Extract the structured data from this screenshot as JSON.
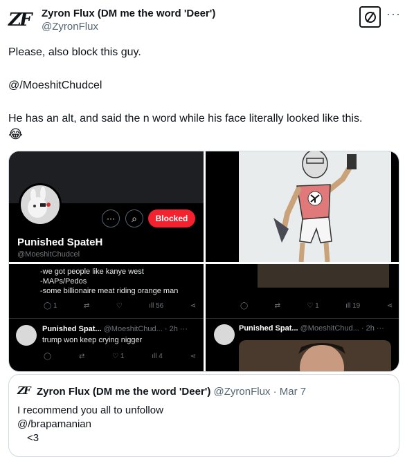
{
  "author": {
    "logo": "ZF",
    "name": "Zyron Flux (DM me the word 'Deer')",
    "handle": "@ZyronFlux",
    "more": "···"
  },
  "tweet": {
    "line1": "Please, also block this guy.",
    "line2": "@/MoeshitChudcel",
    "line3": "He has an alt, and said the n word while his face literally looked like this.",
    "emoji": "😂"
  },
  "media": {
    "profile": {
      "more_btn": "···",
      "search_btn": "⌕",
      "blocked_label": "Blocked",
      "name": "Punished SpateH",
      "handle": "@MoeshitChudcel"
    },
    "posts_left": {
      "lines": [
        "-we got people like kanye west",
        "-MAPs/Pedos",
        "-some billionaire meat riding orange man"
      ],
      "stats": {
        "replies": "1",
        "likes": "",
        "views": "56"
      },
      "reply": {
        "name": "Punished Spat...",
        "handle": "@MoeshitChud...",
        "time": "· 2h",
        "more": "···",
        "text": "trump won keep crying nigger",
        "stats": {
          "likes": "1",
          "views": "4"
        }
      }
    },
    "posts_right": {
      "stats": {
        "likes": "1",
        "views": "19"
      },
      "reply": {
        "name": "Punished Spat...",
        "handle": "@MoeshitChud...",
        "time": "· 2h",
        "more": "···"
      }
    }
  },
  "quote": {
    "logo": "ZF",
    "name": "Zyron Flux (DM me the word 'Deer')",
    "handle": "@ZyronFlux",
    "date": "· Mar 7",
    "line1": "I recommend you all to unfollow",
    "line2": "@/brapamanian",
    "line3": "<3"
  },
  "colors": {
    "blocked": "#f4212e",
    "text": "#0f1419",
    "muted": "#536471",
    "dark_bg": "#000000"
  }
}
